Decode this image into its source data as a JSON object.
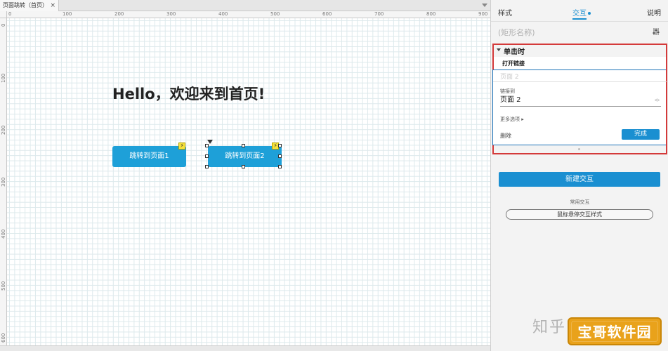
{
  "document": {
    "tab_title": "页面跳转（首页）",
    "tab_close": "×"
  },
  "ruler": {
    "top_ticks": [
      "0",
      "100",
      "200",
      "300",
      "400",
      "500",
      "600",
      "700",
      "800",
      "900"
    ],
    "left_ticks": [
      "0",
      "100",
      "200",
      "300",
      "400",
      "500",
      "600"
    ]
  },
  "canvas": {
    "heading": "Hello，欢迎来到首页!",
    "button1_label": "跳转到页面1",
    "button2_label": "跳转到页面2",
    "lightning_icon_glyph": "⚡"
  },
  "panel": {
    "tabs": {
      "style": "样式",
      "interaction": "交互",
      "notes": "说明"
    },
    "shape_name_placeholder": "(矩形名称)",
    "event": {
      "label": "单击时",
      "action": "打开链接",
      "ghost_value": "页面 2",
      "link_to_label": "链接到",
      "link_target": "页面 2",
      "more_options": "更多选项 ▸",
      "delete": "删除",
      "done": "完成"
    },
    "new_interaction": "新建交互",
    "common_label": "常用交互",
    "hover_style": "鼠标悬停交互样式"
  },
  "watermark": {
    "zhihu": "知乎 @",
    "badge": "宝哥软件园"
  },
  "colors": {
    "accent": "#1a8fd1",
    "button_blue": "#1ea0d8",
    "highlight_red": "#d43a3a",
    "badge_orange": "#e9a21b"
  }
}
